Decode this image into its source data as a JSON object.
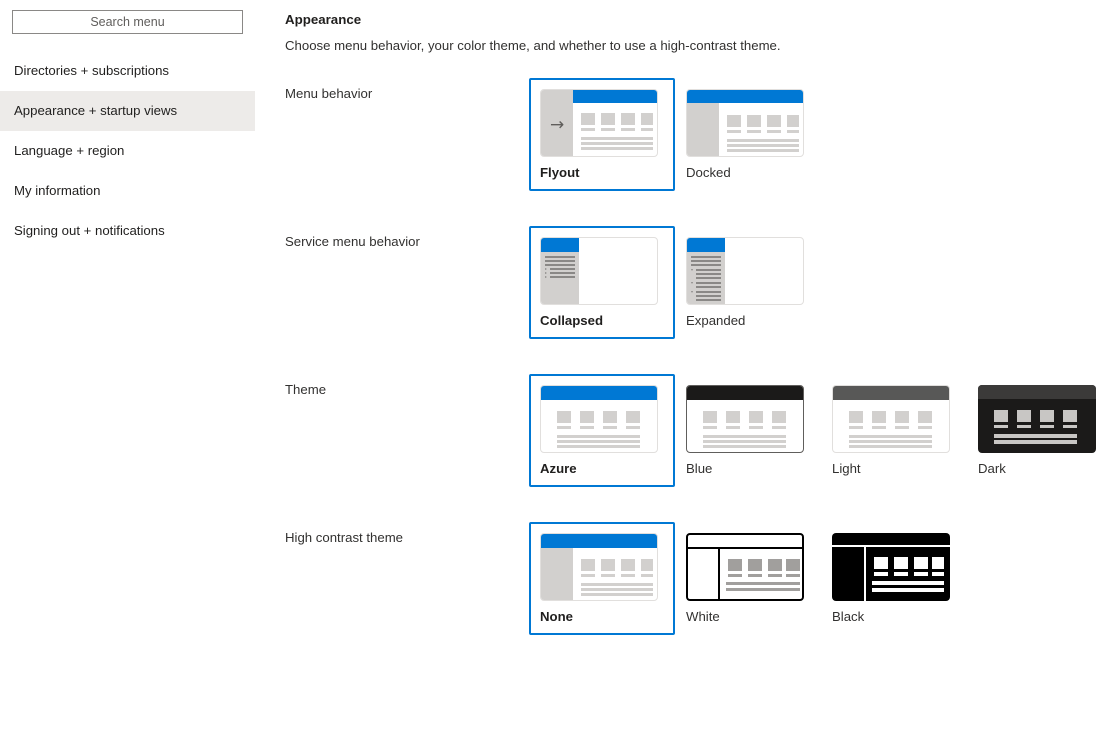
{
  "sidebar": {
    "search": {
      "placeholder": "Search menu",
      "value": ""
    },
    "items": [
      {
        "label": "Directories + subscriptions",
        "selected": false
      },
      {
        "label": "Appearance + startup views",
        "selected": true
      },
      {
        "label": "Language + region",
        "selected": false
      },
      {
        "label": "My information",
        "selected": false
      },
      {
        "label": "Signing out + notifications",
        "selected": false
      }
    ]
  },
  "main": {
    "title": "Appearance",
    "description": "Choose menu behavior, your color theme, and whether to use a high-contrast theme.",
    "accent_color": "#0078d4",
    "groups": [
      {
        "label": "Menu behavior",
        "options": [
          {
            "label": "Flyout",
            "selected": true,
            "variant": "flyout"
          },
          {
            "label": "Docked",
            "selected": false,
            "variant": "docked"
          }
        ]
      },
      {
        "label": "Service menu behavior",
        "options": [
          {
            "label": "Collapsed",
            "selected": true,
            "variant": "collapsed"
          },
          {
            "label": "Expanded",
            "selected": false,
            "variant": "expanded"
          }
        ]
      },
      {
        "label": "Theme",
        "options": [
          {
            "label": "Azure",
            "selected": true,
            "variant": "theme-azure",
            "header_color": "#0078d4",
            "body_color": "#ffffff"
          },
          {
            "label": "Blue",
            "selected": false,
            "variant": "theme-blue",
            "header_color": "#1b1a19",
            "body_color": "#ffffff"
          },
          {
            "label": "Light",
            "selected": false,
            "variant": "theme-light",
            "header_color": "#585857",
            "body_color": "#ffffff"
          },
          {
            "label": "Dark",
            "selected": false,
            "variant": "theme-dark",
            "header_color": "#3b3a39",
            "body_color": "#1b1a19"
          }
        ]
      },
      {
        "label": "High contrast theme",
        "options": [
          {
            "label": "None",
            "selected": true,
            "variant": "hc-none"
          },
          {
            "label": "White",
            "selected": false,
            "variant": "hc-white"
          },
          {
            "label": "Black",
            "selected": false,
            "variant": "hc-black"
          }
        ]
      }
    ]
  }
}
